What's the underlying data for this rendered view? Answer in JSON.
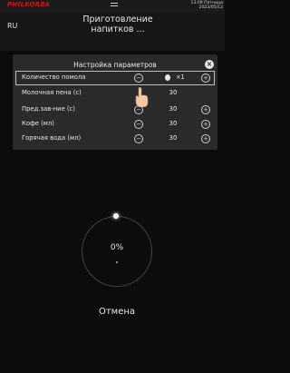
{
  "brand": {
    "name": "PHILKOREA"
  },
  "status_bar": {
    "time": "13:09 Пятница",
    "date": "2023/05/12"
  },
  "header": {
    "language": "RU",
    "title": "Приготовление напитков ..."
  },
  "settings_panel": {
    "title": "Настройка параметров",
    "rows": [
      {
        "label": "Количество помола",
        "value": "×1",
        "selected": true
      },
      {
        "label": "Молочная пена (с)",
        "value": "30"
      },
      {
        "label": "Пред.зав-ние (с)",
        "value": "30"
      },
      {
        "label": "Кофе (мл)",
        "value": "30"
      },
      {
        "label": "Горячая вода (мл)",
        "value": "30"
      }
    ]
  },
  "progress": {
    "percent": "0%",
    "level": 0
  },
  "actions": {
    "cancel_label": "Отмена"
  },
  "colors": {
    "brand": "#d4101c",
    "background": "#0c0c0c",
    "panel": "#2a2a2a"
  }
}
